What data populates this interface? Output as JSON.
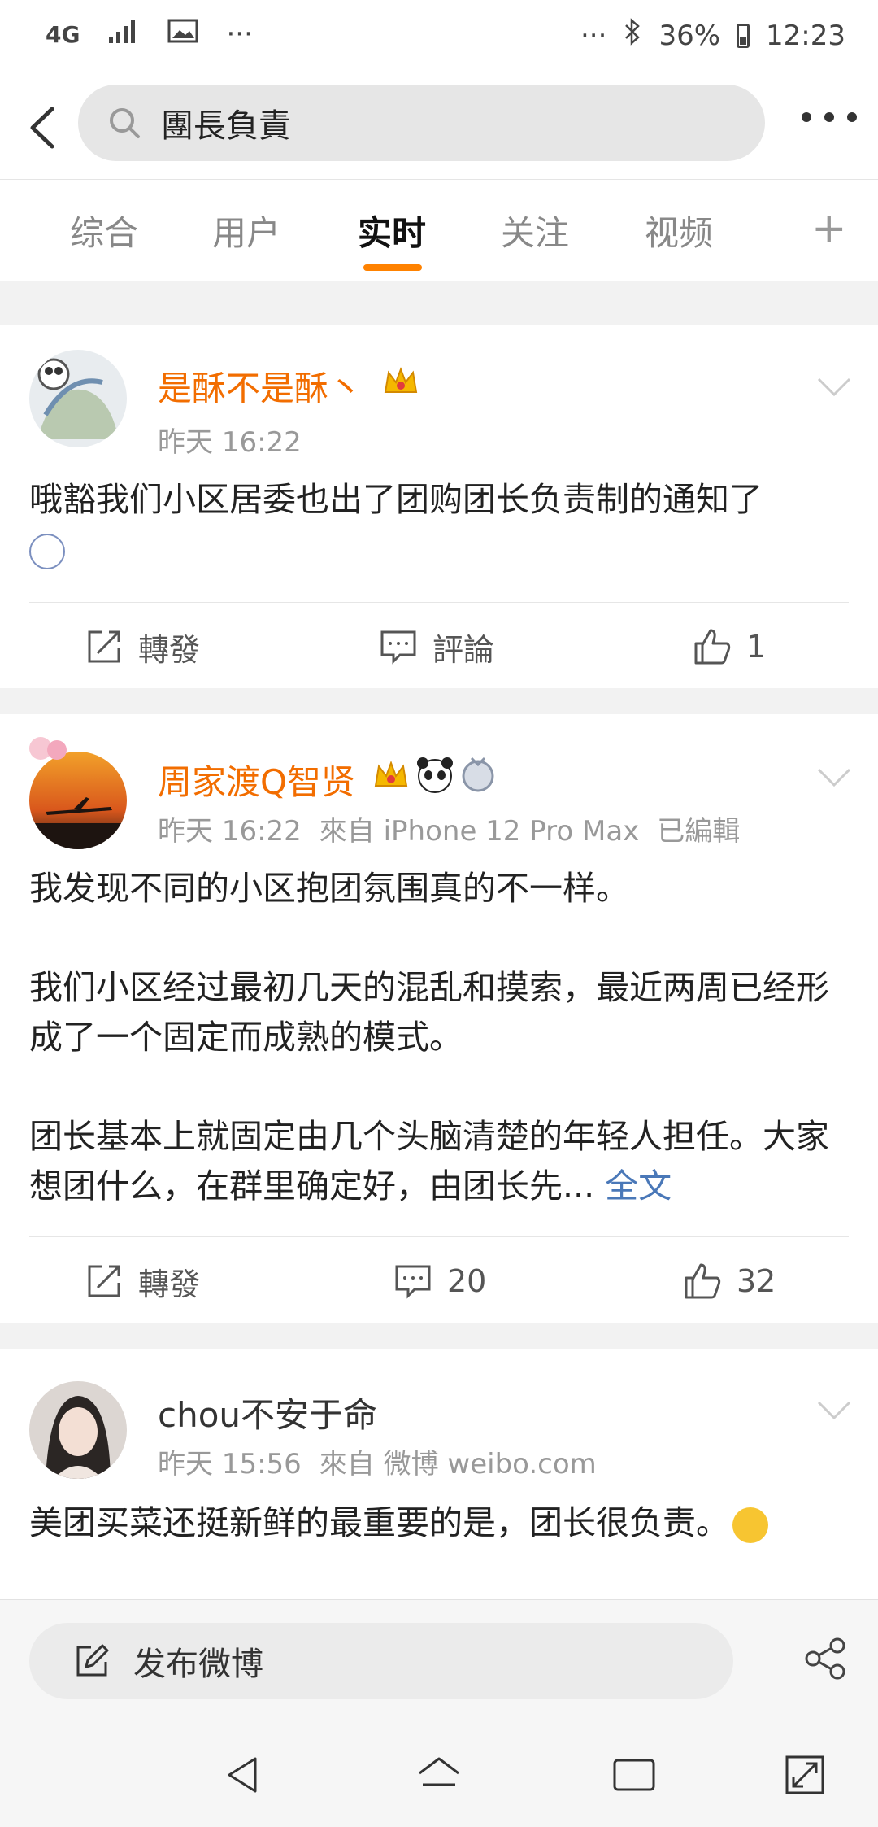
{
  "status_bar": {
    "network": "4G",
    "more_dots": "···",
    "right_dots": "···",
    "battery": "36%",
    "time": "12:23"
  },
  "search": {
    "query": "團長負責"
  },
  "tabs": [
    {
      "label": "综合"
    },
    {
      "label": "用户"
    },
    {
      "label": "实时"
    },
    {
      "label": "关注"
    },
    {
      "label": "视频"
    }
  ],
  "tab_plus": "+",
  "posts": [
    {
      "username": "是酥不是酥丶",
      "time": "昨天 16:22",
      "text": "哦豁我们小区居委也出了团购团长负责制的通知了",
      "actions": {
        "repost": "轉發",
        "comment": "評論",
        "like": "1"
      }
    },
    {
      "username": "周家渡Q智贤",
      "time": "昨天 16:22",
      "source": "來自 iPhone 12 Pro Max",
      "edited": "已編輯",
      "paragraphs": [
        "我发现不同的小区抱团氛围真的不一样。",
        "我们小区经过最初几天的混乱和摸索，最近两周已经形成了一个固定而成熟的模式。",
        "团长基本上就固定由几个头脑清楚的年轻人担任。大家想团什么，在群里确定好，由团长先..."
      ],
      "full_text_link": "全文",
      "actions": {
        "repost": "轉發",
        "comment": "20",
        "like": "32"
      }
    },
    {
      "username": "chou不安于命",
      "time": "昨天 15:56",
      "source": "來自 微博 weibo.com",
      "text": "美团买菜还挺新鲜的最重要的是，团长很负责。"
    }
  ],
  "bottom": {
    "post_label": "发布微博"
  },
  "colors": {
    "accent": "#ff8200",
    "username_orange": "#f26d00",
    "link_blue": "#4a78b8"
  }
}
